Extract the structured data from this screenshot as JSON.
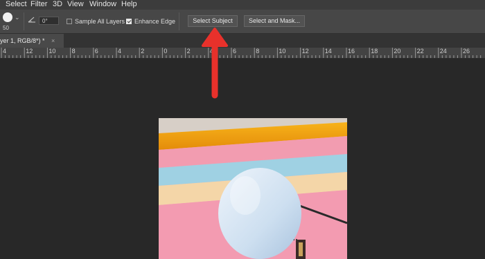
{
  "menubar": {
    "items": [
      "Select",
      "Filter",
      "3D",
      "View",
      "Window",
      "Help"
    ]
  },
  "options": {
    "brush_size": "50",
    "angle_value": "0°",
    "sample_all_layers_label": "Sample All Layers",
    "sample_all_layers_checked": false,
    "enhance_edge_label": "Enhance Edge",
    "enhance_edge_checked": true,
    "select_subject_label": "Select Subject",
    "select_and_mask_label": "Select and Mask..."
  },
  "document_tab": {
    "title": "yer 1, RGB/8*) *",
    "close_symbol": "×"
  },
  "ruler": {
    "labels": [
      "4",
      "12",
      "10",
      "8",
      "6",
      "4",
      "2",
      "0",
      "2",
      "4",
      "6",
      "8",
      "10",
      "12",
      "14",
      "16",
      "18",
      "20",
      "22",
      "24",
      "26"
    ]
  },
  "annotation": {
    "arrow_color": "#e8312b"
  },
  "canvas_image": {
    "description_icon": "photo-balloon-icon"
  }
}
